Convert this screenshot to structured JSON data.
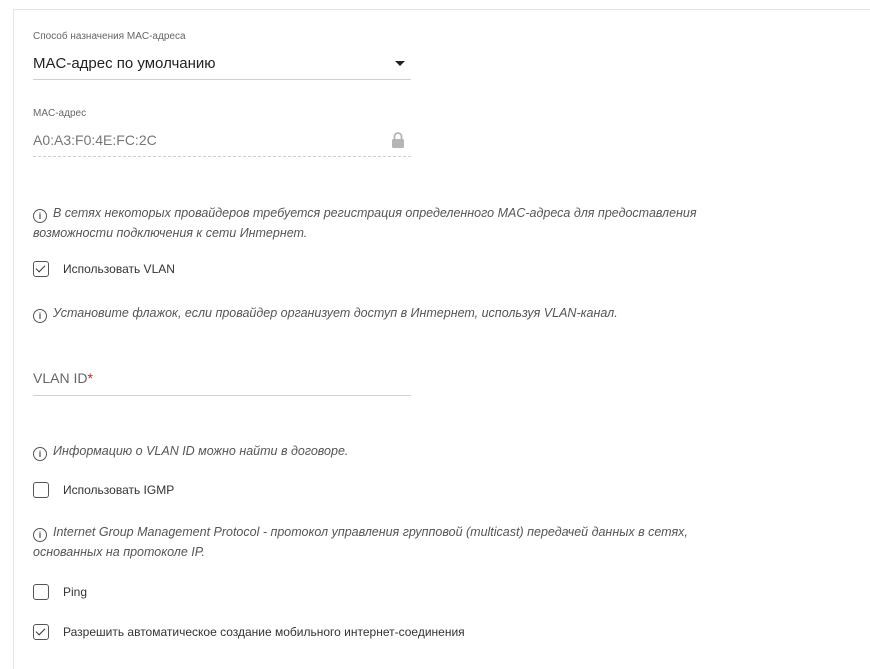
{
  "mac_method": {
    "label": "Способ назначения MAC-адреса",
    "value": "MAC-адрес по умолчанию"
  },
  "mac_address": {
    "label": "MAC-адрес",
    "value": "A0:A3:F0:4E:FC:2C"
  },
  "hints": {
    "mac_line1": "В сетях некоторых провайдеров требуется регистрация определенного MAC-адреса для предоставления",
    "mac_line2": "возможности подключения к сети Интернет.",
    "vlan": "Установите флажок, если провайдер организует доступ в Интернет, используя VLAN-канал.",
    "vlan_id": "Информацию о VLAN ID можно найти в договоре.",
    "igmp_line1": "Internet Group Management Protocol - протокол управления групповой (multicast) передачей данных в сетях,",
    "igmp_line2": "основанных на протоколе IP."
  },
  "checkboxes": {
    "use_vlan": {
      "label": "Использовать VLAN",
      "checked": true
    },
    "use_igmp": {
      "label": "Использовать IGMP",
      "checked": false
    },
    "ping": {
      "label": "Ping",
      "checked": false
    },
    "auto_mobile": {
      "label": "Разрешить автоматическое создание мобильного интернет-соединения",
      "checked": true
    }
  },
  "vlan_id": {
    "label": "VLAN ID",
    "required_mark": "*",
    "value": ""
  },
  "icons": {
    "info": "info-icon",
    "lock": "lock-icon",
    "dropdown": "caret-down-icon"
  },
  "colors": {
    "required": "#d02020",
    "border": "#cfcfcf"
  }
}
